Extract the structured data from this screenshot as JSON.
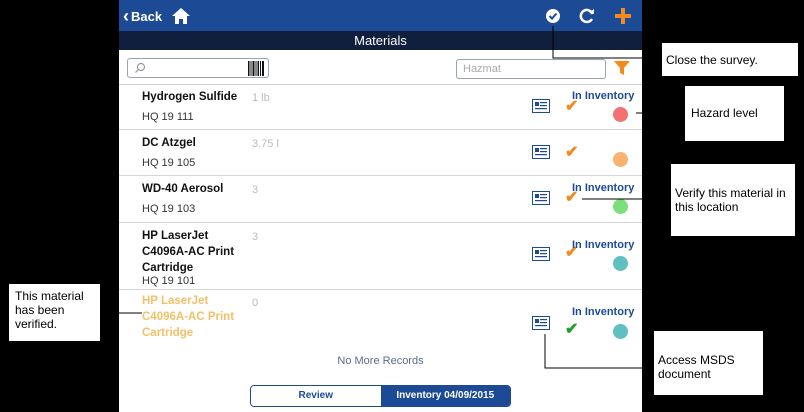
{
  "topbar": {
    "back_label": "Back"
  },
  "title": "Materials",
  "search": {
    "placeholder": "",
    "hazmat_placeholder": "Hazmat"
  },
  "rows": [
    {
      "name": "Hydrogen Sulfide",
      "code": "HQ 19 111",
      "qty": "1 lb",
      "status": "In Inventory",
      "dot_color": "#f27272",
      "verified": false
    },
    {
      "name": "DC Atzgel",
      "code": "HQ 19 105",
      "qty": "3.75 l",
      "status": "",
      "dot_color": "#f8b272",
      "verified": false
    },
    {
      "name": "WD-40 Aerosol",
      "code": "HQ 19 103",
      "qty": "3",
      "status": "In Inventory",
      "dot_color": "#7be07a",
      "verified": false
    },
    {
      "name": "HP LaserJet C4096A-AC Print Cartridge",
      "code": "HQ 19 101",
      "qty": "3",
      "status": "In Inventory",
      "dot_color": "#5fbfc1",
      "verified": false
    },
    {
      "name": "HP LaserJet C4096A-AC Print Cartridge",
      "code": "",
      "qty": "0",
      "status": "In Inventory",
      "dot_color": "#5fbfc1",
      "verified": true
    }
  ],
  "more_records": "No More Records",
  "segment": {
    "review": "Review",
    "inventory": "Inventory 04/09/2015"
  },
  "callouts": {
    "close_survey": "Close the survey.",
    "hazard_level": "Hazard level",
    "verify": "Verify this material in this location",
    "verified": "This material has been verified.",
    "msds": "Access MSDS document"
  },
  "colors": {
    "accent": "#f28a1e",
    "nav": "#1d4a94",
    "checked": "#1f9e2a"
  }
}
